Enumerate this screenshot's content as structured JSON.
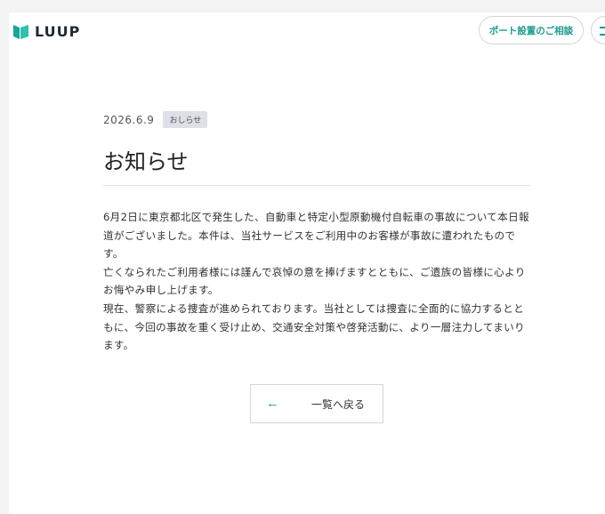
{
  "header": {
    "logo_text": "LUUP",
    "cta_label": "ポート設置のご相談",
    "menu_icon": "hamburger-icon",
    "accent_color": "#1a9b8e"
  },
  "article": {
    "date": "2026.6.9",
    "category": "おしらせ",
    "title": "お知らせ",
    "paragraphs": [
      "6月2日に東京都北区で発生した、自動車と特定小型原動機付自転車の事故について本日報道がございました。本件は、当社サービスをご利用中のお客様が事故に遭われたものです。",
      "亡くなられたご利用者様には謹んで哀悼の意を捧げますとともに、ご遺族の皆様に心よりお悔やみ申し上げます。",
      "現在、警察による捜査が進められております。当社としては捜査に全面的に協力するとともに、今回の事故を重く受け止め、交通安全対策や啓発活動に、より一層注力してまいります。"
    ]
  },
  "back": {
    "arrow": "←",
    "label": "一覧へ戻る"
  }
}
